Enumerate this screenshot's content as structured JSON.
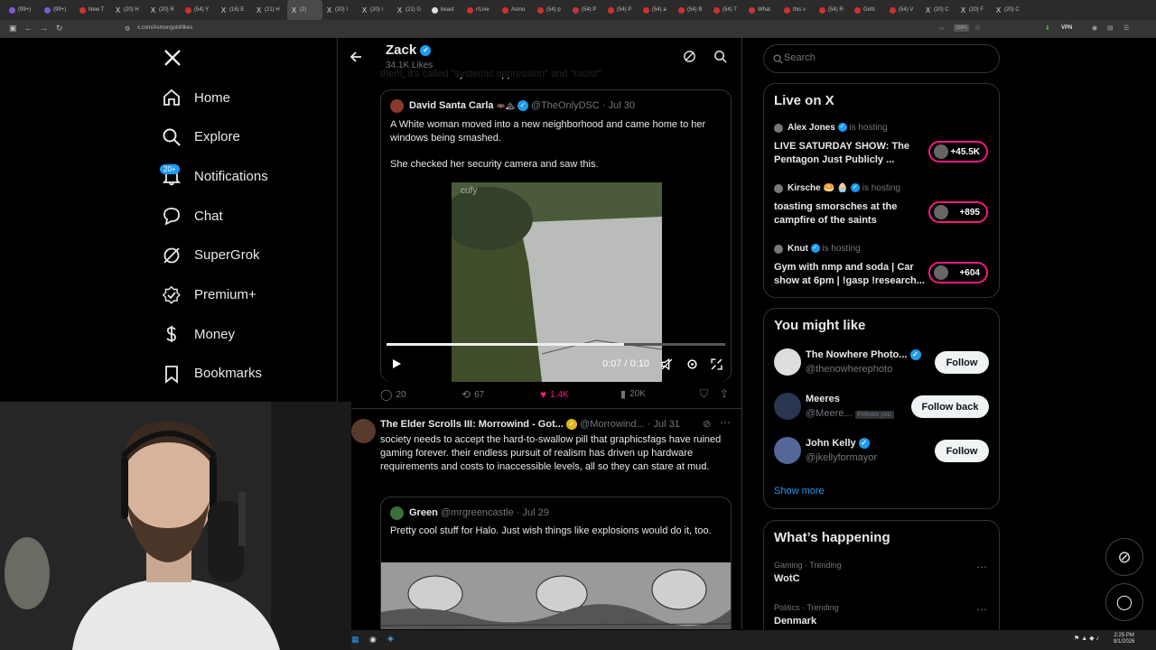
{
  "browser": {
    "tabs": [
      {
        "label": "(99+)",
        "fav": "t"
      },
      {
        "label": "(99+)",
        "fav": "t"
      },
      {
        "label": "New T",
        "fav": "r"
      },
      {
        "label": "(20) H",
        "fav": "x"
      },
      {
        "label": "(20) R",
        "fav": "x"
      },
      {
        "label": "(54) Y",
        "fav": "r"
      },
      {
        "label": "(16) E",
        "fav": "x"
      },
      {
        "label": "(21) H",
        "fav": "x"
      },
      {
        "label": "(2)",
        "fav": "x",
        "active": true
      },
      {
        "label": "(20) I",
        "fav": "x"
      },
      {
        "label": "(20) I",
        "fav": "x"
      },
      {
        "label": "(21) G",
        "fav": "x"
      },
      {
        "label": "beast",
        "fav": "g"
      },
      {
        "label": "r/Live",
        "fav": "r"
      },
      {
        "label": "Asmo",
        "fav": "r"
      },
      {
        "label": "(54) p",
        "fav": "r"
      },
      {
        "label": "(54) P",
        "fav": "r"
      },
      {
        "label": "(54) P",
        "fav": "r"
      },
      {
        "label": "(54) a",
        "fav": "r"
      },
      {
        "label": "(54) B",
        "fav": "r"
      },
      {
        "label": "(54) T",
        "fav": "r"
      },
      {
        "label": "What",
        "fav": "r"
      },
      {
        "label": "this v",
        "fav": "r"
      },
      {
        "label": "(54) R",
        "fav": "r"
      },
      {
        "label": "Getti",
        "fav": "r"
      },
      {
        "label": "(54) V",
        "fav": "r"
      },
      {
        "label": "(20) C",
        "fav": "x"
      },
      {
        "label": "(20) F",
        "fav": "x"
      },
      {
        "label": "(20) C",
        "fav": "x"
      }
    ],
    "url": "x.com/Asmongold/likes",
    "zoom": "150%",
    "vpn": "VPN"
  },
  "nav": {
    "items": [
      {
        "label": "Home",
        "icon": "home-icon"
      },
      {
        "label": "Explore",
        "icon": "search-icon"
      },
      {
        "label": "Notifications",
        "icon": "bell-icon"
      },
      {
        "label": "Chat",
        "icon": "chat-icon"
      },
      {
        "label": "SuperGrok",
        "icon": "grok-icon"
      },
      {
        "label": "Premium+",
        "icon": "premium-icon"
      },
      {
        "label": "Money",
        "icon": "money-icon"
      },
      {
        "label": "Bookmarks",
        "icon": "bookmark-icon"
      }
    ],
    "notif_badge": "20+"
  },
  "profile": {
    "name": "Zack",
    "likes": "34.1K Likes"
  },
  "tweet1": {
    "top_text": "them, it's called \"systemic oppression\" and \"racist\".",
    "quote": {
      "name": "David Santa Carla",
      "emoji": "🦇🏔",
      "handle": "@TheOnlyDSC",
      "date": "Jul 30",
      "text1": "A White woman moved into a new neighborhood and came home to her windows being smashed.",
      "text2": "She checked her security camera and saw this.",
      "watermark": "cufy",
      "time": "0:07 / 0:10",
      "progress": 0.7
    },
    "replies": "20",
    "reposts": "67",
    "likes": "1.4K",
    "views": "20K"
  },
  "tweet2": {
    "name": "The Elder Scrolls III: Morrowind - Got...",
    "handle": "@Morrowind...",
    "date": "Jul 31",
    "text": "society needs to accept the hard-to-swallow pill that graphicsfags have ruined gaming forever. their endless pursuit of realism has driven up hardware requirements and costs to inaccessible levels, all so they can stare at mud.",
    "quote": {
      "name": "Green",
      "handle": "@mrgreencastle",
      "date": "Jul 29",
      "text": "Pretty cool stuff for Halo. Just wish things like explosions would do it, too."
    }
  },
  "search": {
    "placeholder": "Search"
  },
  "live": {
    "title": "Live on X",
    "hosting": "is hosting",
    "items": [
      {
        "host": "Alex Jones",
        "title1": "LIVE SATURDAY SHOW: The",
        "title2": "Pentagon Just Publicly ...",
        "count": "+45.5K"
      },
      {
        "host": "Kirsche 🥯 🧁",
        "title1": "toasting smorsches at the",
        "title2": "campfire of the saints",
        "count": "+895"
      },
      {
        "host": "Knut",
        "title1": "Gym with nmp and soda | Car",
        "title2": "show at 6pm | !gasp !research...",
        "count": "+604"
      }
    ]
  },
  "wtf": {
    "title": "You might like",
    "items": [
      {
        "name": "The Nowhere Photo...",
        "handle": "@thenowherephoto",
        "btn": "Follow",
        "verified": true
      },
      {
        "name": "Meeres",
        "handle": "@Meere...",
        "follows_you": "Follows you",
        "btn": "Follow back",
        "verified": false
      },
      {
        "name": "John Kelly",
        "handle": "@jkellyformayor",
        "btn": "Follow",
        "verified": true
      }
    ],
    "show_more": "Show more"
  },
  "trends": {
    "title": "What’s happening",
    "items": [
      {
        "meta": "Gaming · Trending",
        "name": "WotC"
      },
      {
        "meta": "Politics · Trending",
        "name": "Denmark"
      }
    ]
  },
  "taskbar": {
    "time": "2:25 PM",
    "date": "8/1/2026"
  },
  "colors": {
    "accent": "#1d9bf0",
    "like": "#f91880",
    "live": "#f91880",
    "bg": "#000000",
    "border": "#2f3336"
  }
}
